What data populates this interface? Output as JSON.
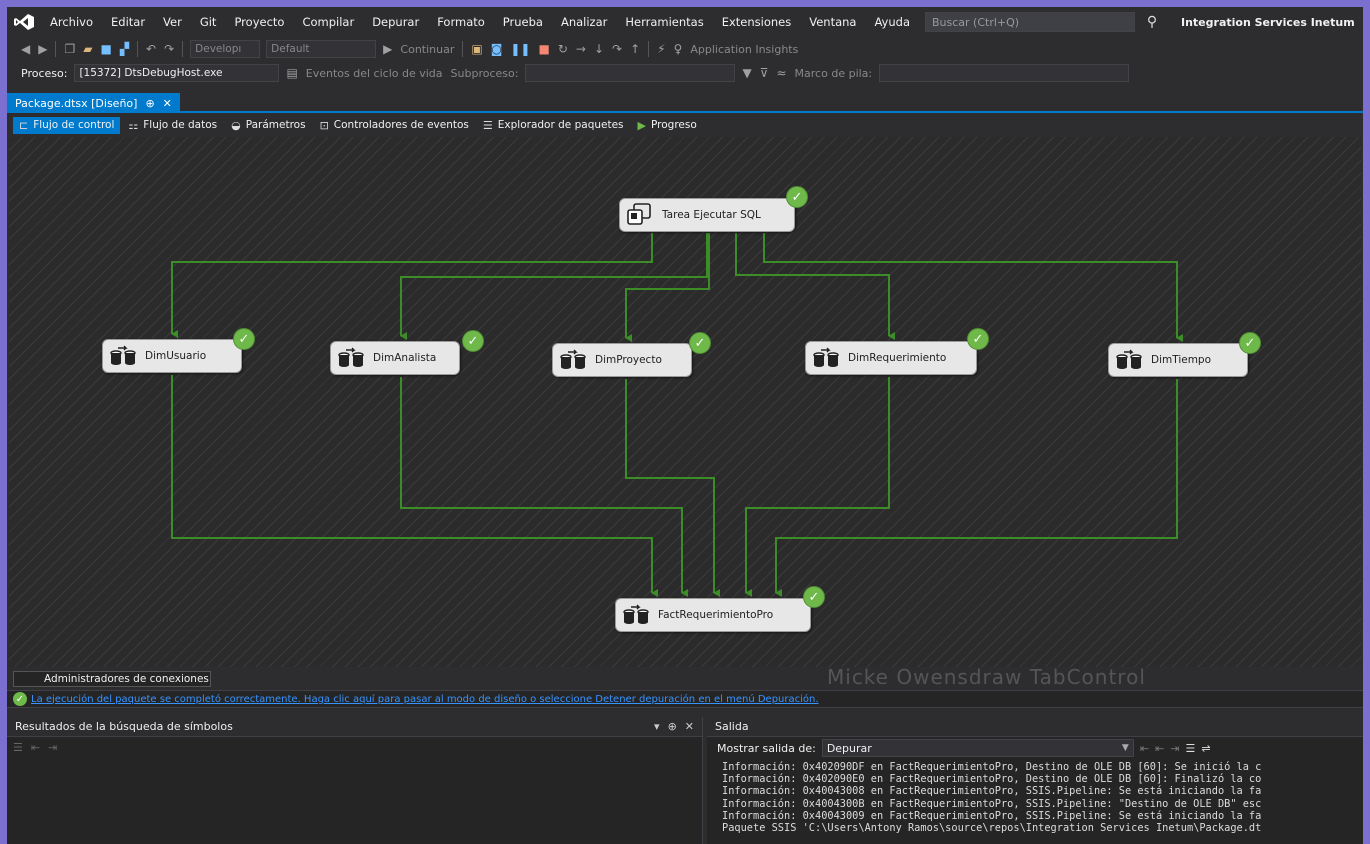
{
  "menu": {
    "items": [
      "Archivo",
      "Editar",
      "Ver",
      "Git",
      "Proyecto",
      "Compilar",
      "Depurar",
      "Formato",
      "Prueba",
      "Analizar",
      "Herramientas",
      "Extensiones",
      "Ventana",
      "Ayuda"
    ],
    "search_placeholder": "Buscar (Ctrl+Q)",
    "solution_name": "Integration Services Inetum"
  },
  "toolbar1": {
    "config_combo": "Developı",
    "platform_combo": "Default",
    "continue_label": "Continuar",
    "app_insights_label": "Application Insights"
  },
  "toolbar2": {
    "process_label": "Proceso:",
    "process_value": "[15372] DtsDebugHost.exe",
    "lifecycle_label": "Eventos del ciclo de vida",
    "thread_label": "Subproceso:",
    "stack_label": "Marco de pila:"
  },
  "doc_tab": {
    "title": "Package.dtsx [Diseño]",
    "pin": "⊕",
    "close": "✕"
  },
  "designer_tabs": [
    {
      "label": "Flujo de control",
      "icon": "control-flow-icon"
    },
    {
      "label": "Flujo de datos",
      "icon": "data-flow-icon"
    },
    {
      "label": "Parámetros",
      "icon": "parameters-icon"
    },
    {
      "label": "Controladores de eventos",
      "icon": "event-handlers-icon"
    },
    {
      "label": "Explorador de paquetes",
      "icon": "package-explorer-icon"
    },
    {
      "label": "Progreso",
      "icon": "progress-icon"
    }
  ],
  "tasks": {
    "sql": "Tarea Ejecutar SQL",
    "dim_usuario": "DimUsuario",
    "dim_analista": "DimAnalista",
    "dim_proyecto": "DimProyecto",
    "dim_requerimiento": "DimRequerimiento",
    "dim_tiempo": "DimTiempo",
    "fact": "FactRequerimientoPro"
  },
  "colors": {
    "accent": "#007acc",
    "connector": "#3c8c28",
    "success": "#6fb84a",
    "link": "#3794ff"
  },
  "bottom": {
    "conn_managers_tab": "Administradores de conexiones",
    "watermark": "Micke Owensdraw TabControl",
    "status_message": "La ejecución del paquete se completó correctamente. Haga clic aquí para pasar al modo de diseño o seleccione Detener depuración en el menú Depuración."
  },
  "symbol_results": {
    "title": "Resultados de la búsqueda de símbolos"
  },
  "output": {
    "title": "Salida",
    "show_label": "Mostrar salida de:",
    "source": "Depurar",
    "lines": [
      "Información: 0x402090DF en FactRequerimientoPro, Destino de OLE DB [60]: Se inició la c",
      "Información: 0x402090E0 en FactRequerimientoPro, Destino de OLE DB [60]: Finalizó la co",
      "Información: 0x40043008 en FactRequerimientoPro, SSIS.Pipeline: Se está iniciando la fa",
      "Información: 0x4004300B en FactRequerimientoPro, SSIS.Pipeline: \"Destino de OLE DB\" esc",
      "Información: 0x40043009 en FactRequerimientoPro, SSIS.Pipeline: Se está iniciando la fa",
      "Paquete SSIS 'C:\\Users\\Antony Ramos\\source\\repos\\Integration Services Inetum\\Package.dt"
    ]
  }
}
